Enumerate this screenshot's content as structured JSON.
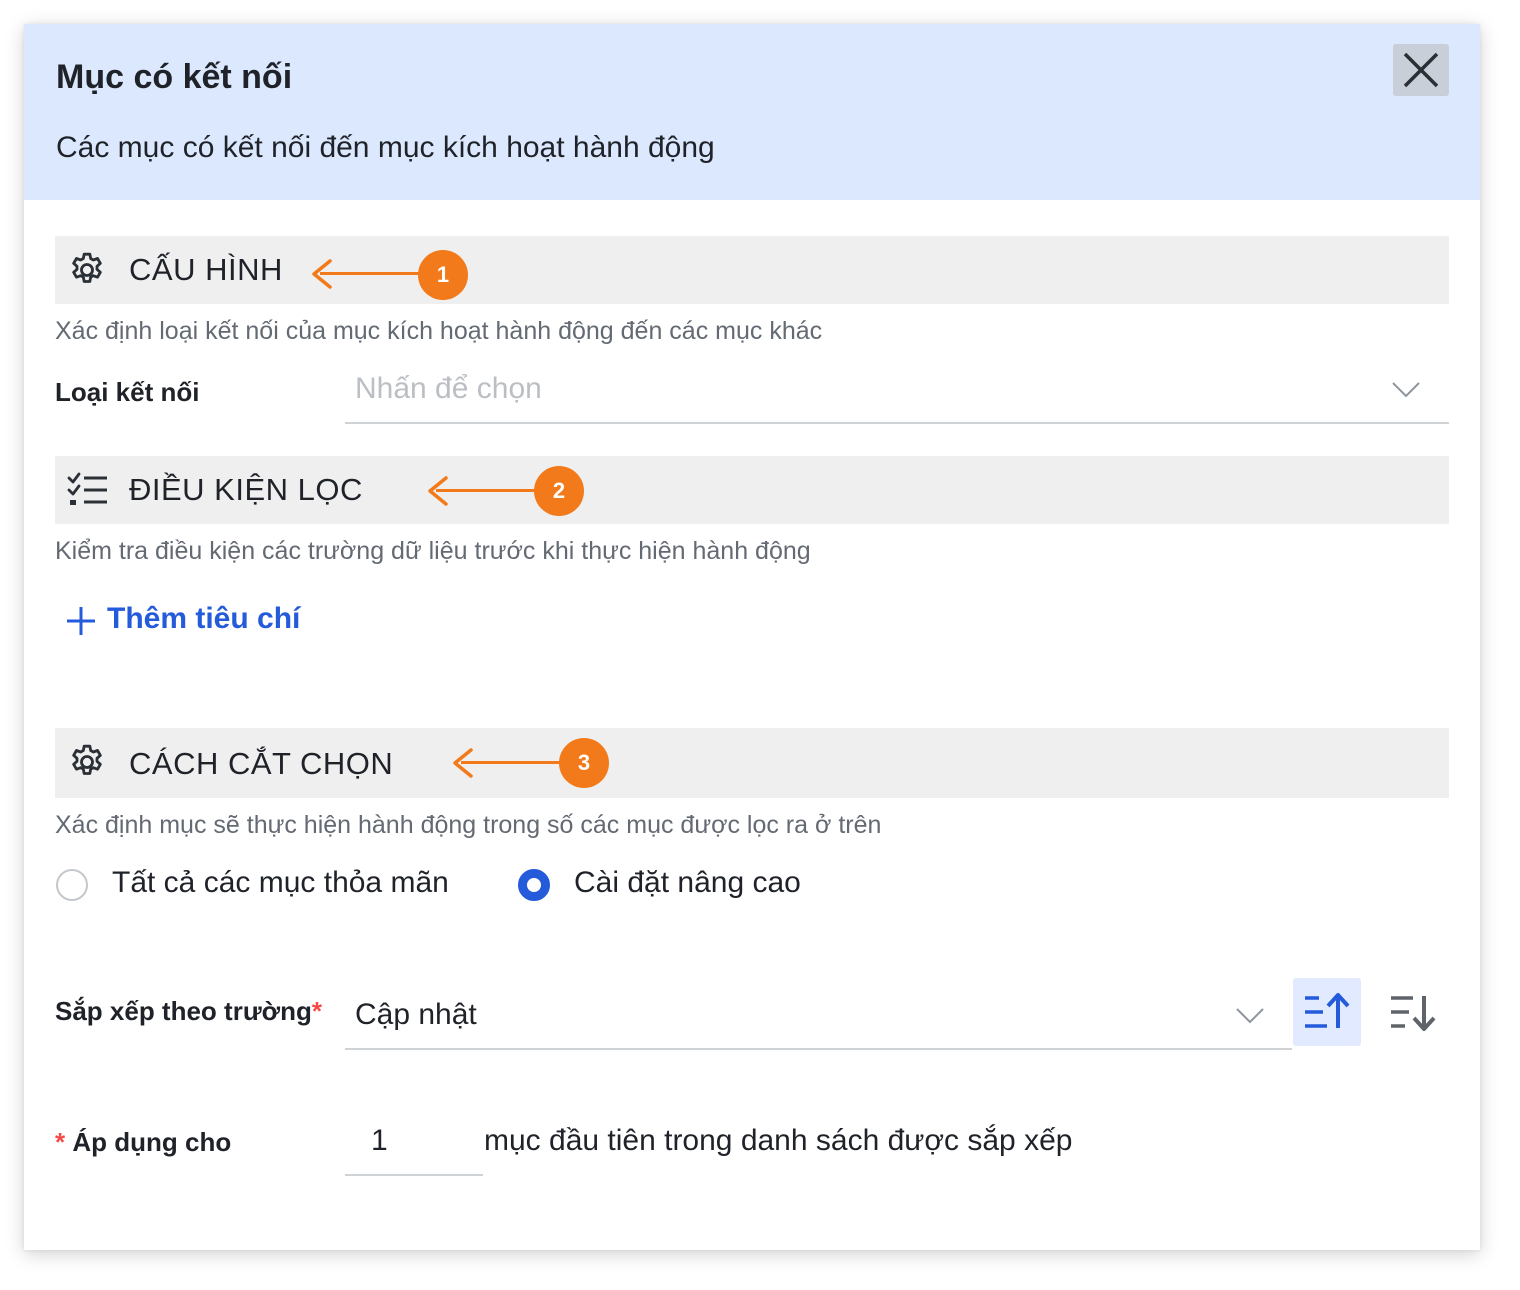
{
  "dialog": {
    "title": "Mục có kết nối",
    "subtitle": "Các mục có kết nối đến mục kích hoạt hành động",
    "close_icon": "close-icon"
  },
  "config": {
    "heading": "CẤU HÌNH",
    "icon": "gear-icon",
    "description": "Xác định loại kết nối của mục kích hoạt hành động đến các mục khác",
    "connection_label": "Loại kết nối",
    "connection_placeholder": "Nhấn để chọn",
    "callout_number": "1"
  },
  "filter": {
    "heading": "ĐIỀU KIỆN LỌC",
    "icon": "checklist-icon",
    "description": "Kiểm tra điều kiện các trường dữ liệu trước khi thực hiện hành động",
    "add_label": "Thêm tiêu chí",
    "callout_number": "2"
  },
  "selection": {
    "heading": "CÁCH CẮT CHỌN",
    "icon": "gear-icon",
    "description": "Xác định mục sẽ thực hiện hành động trong số các mục được lọc ra ở trên",
    "callout_number": "3",
    "options": [
      {
        "label": "Tất cả các mục thỏa mãn",
        "selected": false
      },
      {
        "label": "Cài đặt nâng cao",
        "selected": true
      }
    ],
    "sort_label": "Sắp xếp theo trường",
    "sort_required_mark": "*",
    "sort_value": "Cập nhật",
    "sort_direction": "ascending",
    "apply_required_mark": "*",
    "apply_label": "Áp dụng cho",
    "apply_value": "1",
    "apply_suffix": "mục đầu tiên trong danh sách được sắp xếp"
  },
  "colors": {
    "header_bg": "#dbe8fd",
    "accent": "#245bdb",
    "callout": "#f27a1a",
    "required": "#f54a45"
  }
}
